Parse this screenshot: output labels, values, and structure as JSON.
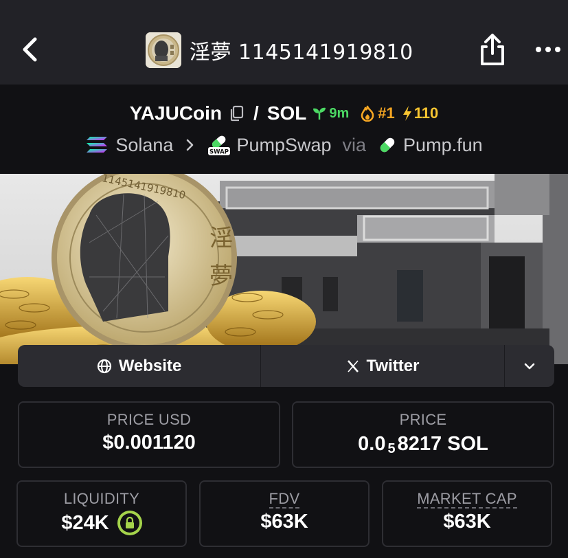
{
  "header": {
    "title": "淫夢 1145141919810",
    "back_icon": "chevron-left-icon",
    "share_icon": "share-icon",
    "more_icon": "more-horizontal-icon"
  },
  "pair": {
    "base": "YAJUCoin",
    "separator": "/",
    "quote": "SOL",
    "age": "9m",
    "rank": "#1",
    "boosts": "110"
  },
  "chain": {
    "network": "Solana",
    "dex": "PumpSwap",
    "dex_badge": "SWAP",
    "via_label": "via",
    "launchpad": "Pump.fun"
  },
  "links": {
    "website": "Website",
    "twitter": "Twitter"
  },
  "stats": {
    "price_usd": {
      "label": "PRICE USD",
      "value": "$0.001120"
    },
    "price": {
      "label": "PRICE",
      "prefix": "0.0",
      "subscript": "5",
      "suffix": "8217 SOL"
    },
    "liquidity": {
      "label": "LIQUIDITY",
      "value": "$24K"
    },
    "fdv": {
      "label": "FDV",
      "value": "$63K"
    },
    "market_cap": {
      "label": "MARKET CAP",
      "value": "$63K"
    }
  },
  "colors": {
    "accent_green": "#4cd964",
    "accent_orange": "#f5a623",
    "accent_yellow": "#f8c531",
    "lock_green": "#a5d44b",
    "background": "#111114",
    "topbar": "#222227"
  },
  "banner_text": {
    "coin_number": "1145141919810",
    "coin_glyph_1": "淫",
    "coin_glyph_2": "夢"
  }
}
